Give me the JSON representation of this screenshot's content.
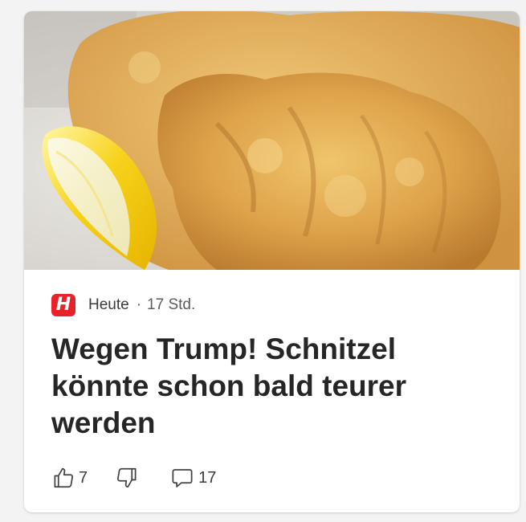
{
  "card": {
    "source": {
      "logo_letter": "H",
      "name": "Heute",
      "separator": "·",
      "time": "17 Std.",
      "brand_color": "#e8222b"
    },
    "headline": "Wegen Trump! Schnitzel könnte schon bald teurer werden",
    "actions": {
      "like": {
        "icon": "thumbs-up-icon",
        "count": "7"
      },
      "dislike": {
        "icon": "thumbs-down-icon"
      },
      "comment": {
        "icon": "comment-icon",
        "count": "17"
      }
    }
  }
}
